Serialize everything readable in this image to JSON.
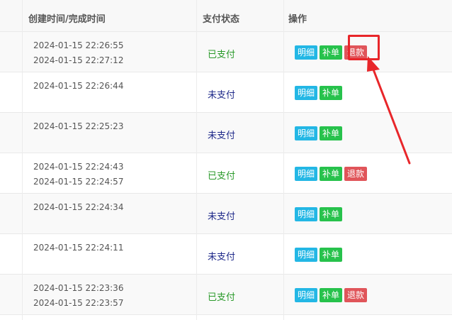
{
  "table": {
    "headers": {
      "time": "创建时间/完成时间",
      "status": "支付状态",
      "actions": "操作"
    },
    "buttons": {
      "detail": "明细",
      "reissue": "补单",
      "refund": "退款"
    },
    "rows": [
      {
        "created": "2024-01-15 22:26:55",
        "completed": "2024-01-15 22:27:12",
        "status": "已支付",
        "paid": true
      },
      {
        "created": "2024-01-15 22:26:44",
        "completed": "",
        "status": "未支付",
        "paid": false
      },
      {
        "created": "2024-01-15 22:25:23",
        "completed": "",
        "status": "未支付",
        "paid": false
      },
      {
        "created": "2024-01-15 22:24:43",
        "completed": "2024-01-15 22:24:57",
        "status": "已支付",
        "paid": true
      },
      {
        "created": "2024-01-15 22:24:34",
        "completed": "",
        "status": "未支付",
        "paid": false
      },
      {
        "created": "2024-01-15 22:24:11",
        "completed": "",
        "status": "未支付",
        "paid": false
      },
      {
        "created": "2024-01-15 22:23:36",
        "completed": "2024-01-15 22:23:57",
        "status": "已支付",
        "paid": true
      }
    ]
  },
  "colors": {
    "detail_button": "#23b7e5",
    "reissue_button": "#27c24c",
    "refund_button": "#e0555a",
    "paid_text": "#2a9a2a",
    "unpaid_text": "#1f2a8a",
    "annotation_red": "#e8262a"
  }
}
